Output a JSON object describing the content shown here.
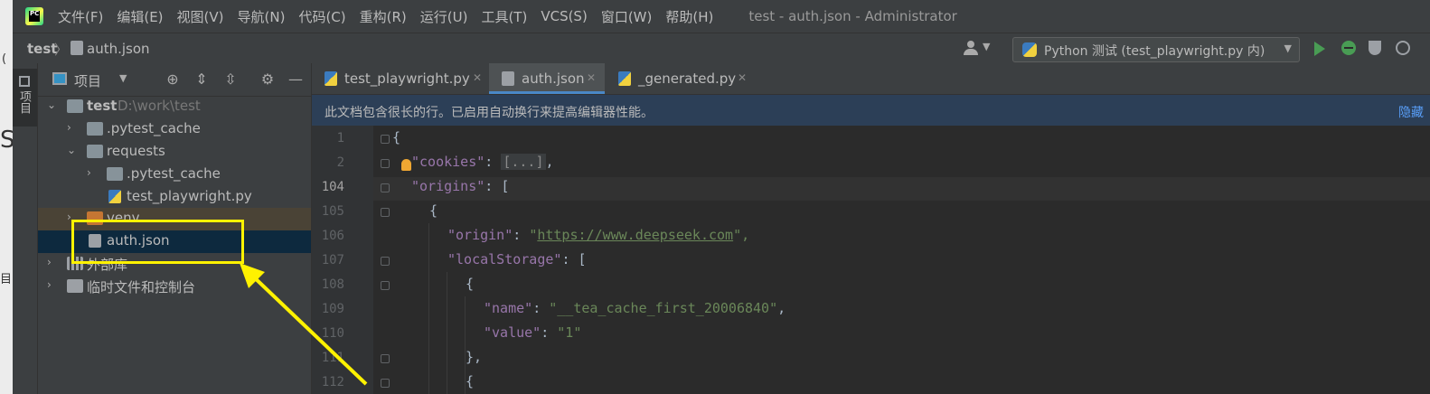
{
  "sliver": {
    "chars": [
      "(",
      "S",
      "目"
    ]
  },
  "menubar": {
    "items": [
      "文件(F)",
      "编辑(E)",
      "视图(V)",
      "导航(N)",
      "代码(C)",
      "重构(R)",
      "运行(U)",
      "工具(T)",
      "VCS(S)",
      "窗口(W)",
      "帮助(H)"
    ],
    "window_title": "test - auth.json - Administrator",
    "logo_text": "PC"
  },
  "navbar": {
    "breadcrumb": [
      "test",
      "auth.json"
    ],
    "separator": "〉",
    "run_config": "Python 测试 (test_playwright.py 内)"
  },
  "toolstrip": {
    "label": "项目"
  },
  "project": {
    "title": "项目",
    "tree": [
      {
        "label": "test",
        "hint": "D:\\work\\test",
        "type": "folder",
        "expanded": true
      },
      {
        "label": ".pytest_cache",
        "type": "folder",
        "expanded": false
      },
      {
        "label": "requests",
        "type": "folder",
        "expanded": true
      },
      {
        "label": ".pytest_cache",
        "type": "folder",
        "expanded": false
      },
      {
        "label": "test_playwright.py",
        "type": "python"
      },
      {
        "label": "venv",
        "type": "folder-excluded",
        "expanded": false
      },
      {
        "label": "auth.json",
        "type": "json",
        "selected": true
      },
      {
        "label": "外部库",
        "type": "library",
        "expanded": false
      },
      {
        "label": "临时文件和控制台",
        "type": "scratch",
        "expanded": false
      }
    ]
  },
  "tabs": [
    {
      "label": "test_playwright.py",
      "type": "python",
      "active": false
    },
    {
      "label": "auth.json",
      "type": "json",
      "active": true
    },
    {
      "label": "_generated.py",
      "type": "python",
      "active": false
    }
  ],
  "notice": {
    "text": "此文档包含很长的行。已启用自动换行来提高编辑器性能。",
    "link": "隐藏"
  },
  "editor": {
    "line_numbers": [
      "1",
      "2",
      "104",
      "105",
      "106",
      "107",
      "108",
      "109",
      "110",
      "111",
      "112"
    ],
    "current_line": "104",
    "code": {
      "l1_brace": "{",
      "l2_key": "\"cookies\"",
      "l2_colon": ": ",
      "l2_folded": "[...]",
      "l2_comma": ",",
      "l3_key": "\"origins\"",
      "l3_rest": ": [",
      "l4": "{",
      "l5_key": "\"origin\"",
      "l5_colon": ": ",
      "l5_q1": "\"",
      "l5_url": "https://www.deepseek.com",
      "l5_q2": "\",",
      "l6_key": "\"localStorage\"",
      "l6_rest": ": [",
      "l7": "{",
      "l8_key": "\"name\"",
      "l8_colon": ": ",
      "l8_val": "\"__tea_cache_first_20006840\"",
      "l8_comma": ",",
      "l9_key": "\"value\"",
      "l9_colon": ": ",
      "l9_val": "\"1\"",
      "l10": "},",
      "l11": "{"
    }
  },
  "annotation": {
    "color": "#fff200"
  }
}
